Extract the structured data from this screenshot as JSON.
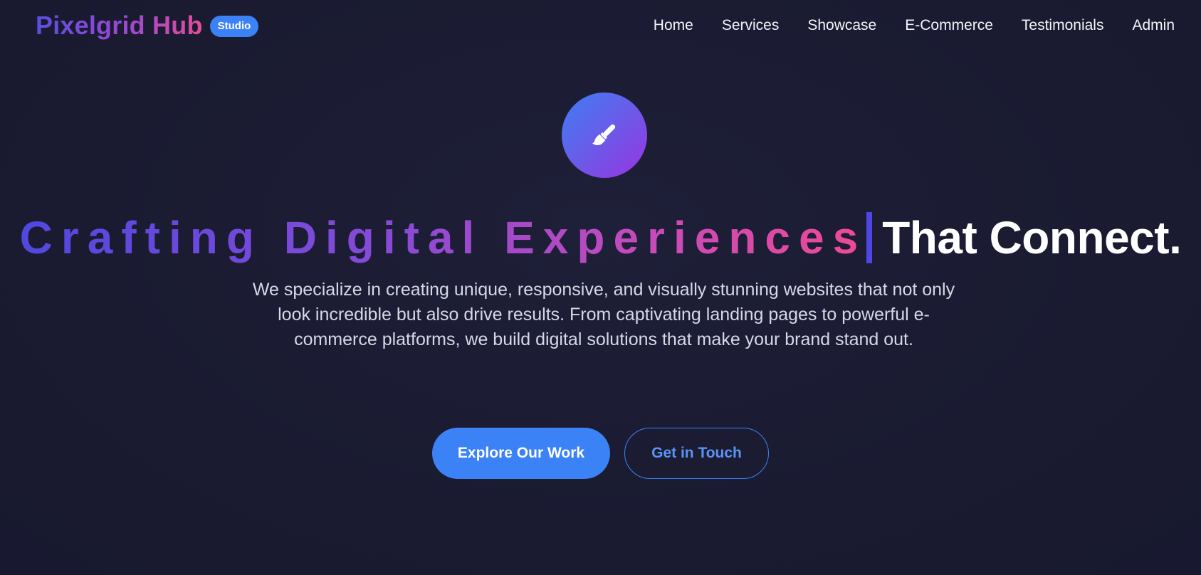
{
  "header": {
    "brand_name": "Pixelgrid Hub",
    "brand_badge": "Studio",
    "nav": [
      {
        "label": "Home"
      },
      {
        "label": "Services"
      },
      {
        "label": "Showcase"
      },
      {
        "label": "E-Commerce"
      },
      {
        "label": "Testimonials"
      },
      {
        "label": "Admin"
      }
    ]
  },
  "hero": {
    "icon": "paintbrush-icon",
    "headline_gradient": "Crafting Digital Experiences",
    "headline_white": "That Connect.",
    "description": "We specialize in creating unique, responsive, and visually stunning websites that not only look incredible but also drive results. From captivating landing pages to powerful e-commerce platforms, we build digital solutions that make your brand stand out.",
    "primary_cta": "Explore Our Work",
    "secondary_cta": "Get in Touch"
  },
  "colors": {
    "background": "#1b1c33",
    "accent_blue": "#3b82f6",
    "gradient_start": "#5048e0",
    "gradient_end": "#ee4a95",
    "cursor": "#4f46e5"
  }
}
